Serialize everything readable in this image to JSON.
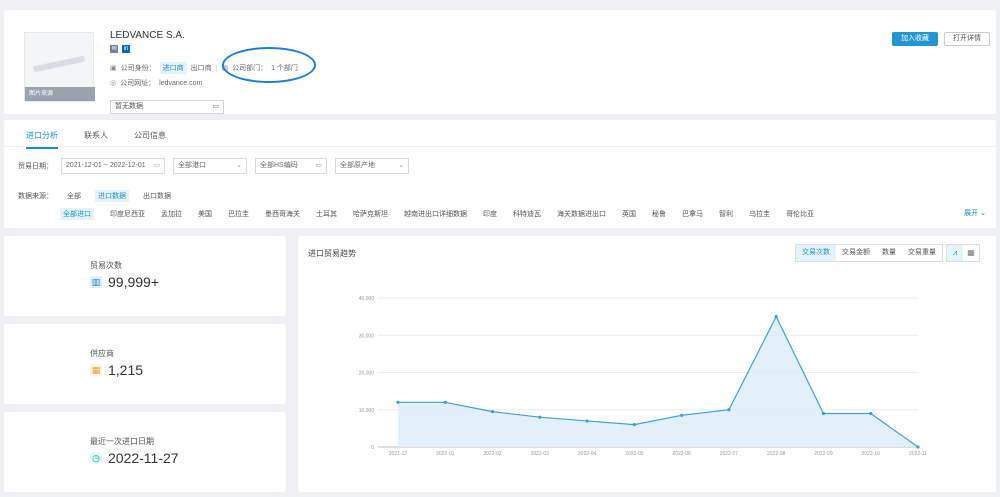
{
  "header": {
    "company_name": "LEDVANCE S.A.",
    "logo_badge": "图片来源",
    "role_label": "公司身份：",
    "role_tag_1": "进口商",
    "role_tag_2": "出口商",
    "dept_label": "公司部门：",
    "dept_value": "1 个部门",
    "website_label": "公司网址：",
    "website_value": "ledvance.com",
    "date_value": "暂无数据",
    "add_button": "加入收藏",
    "open_button": "打开详情"
  },
  "tabs": [
    {
      "label": "进口分析",
      "active": true
    },
    {
      "label": "联系人",
      "active": false
    },
    {
      "label": "公司信息",
      "active": false
    }
  ],
  "filters": {
    "date_label": "贸易日期：",
    "date_start": "2021-12-01",
    "date_sep": "~",
    "date_end": "2022-12-01",
    "region": "全部港口",
    "category": "全部HS编码",
    "country": "全部原产地"
  },
  "source": {
    "label": "数据来源：",
    "items": [
      {
        "label": "全部",
        "selected": false
      },
      {
        "label": "进口数据",
        "selected": true
      },
      {
        "label": "出口数据",
        "selected": false
      }
    ]
  },
  "categories": {
    "items": [
      "全部进口",
      "印度尼西亚",
      "孟加拉",
      "美国",
      "巴拉圭",
      "墨西哥海关",
      "土耳其",
      "哈萨克斯坦",
      "越南进出口详细数据",
      "印度",
      "科特迪瓦",
      "海关数据进出口",
      "英国",
      "秘鲁",
      "巴拿马",
      "智利",
      "乌拉圭",
      "哥伦比亚"
    ],
    "expand_label": "展开"
  },
  "stats": [
    {
      "label": "贸易次数",
      "value": "99,999+",
      "icon": "bar-chart-icon",
      "color": "#2a7fd4",
      "bg": "#e1eefb"
    },
    {
      "label": "供应商",
      "value": "1,215",
      "icon": "store-icon",
      "color": "#e6a23c",
      "bg": "#fdf3e2"
    },
    {
      "label": "最近一次进口日期",
      "value": "2022-11-27",
      "icon": "clock-icon",
      "color": "#23b2a7",
      "bg": "#e0f5f3"
    }
  ],
  "chart_header": {
    "title": "进口贸易趋势",
    "metrics": [
      {
        "label": "交易次数",
        "active": true
      },
      {
        "label": "交易金额",
        "active": false
      },
      {
        "label": "数量",
        "active": false
      },
      {
        "label": "交易重量",
        "active": false
      }
    ],
    "views": [
      {
        "icon": "line-chart-icon",
        "glyph": "⩘",
        "active": true
      },
      {
        "icon": "table-icon",
        "glyph": "▦",
        "active": false
      }
    ]
  },
  "chart_data": {
    "type": "area",
    "title": "进口贸易趋势",
    "x": [
      "2021-12",
      "2022-01",
      "2022-02",
      "2022-03",
      "2022-04",
      "2022-05",
      "2022-06",
      "2022-07",
      "2022-08",
      "2022-09",
      "2022-10",
      "2022-11"
    ],
    "values": [
      12000,
      12000,
      9500,
      8000,
      7000,
      6000,
      8500,
      10000,
      35000,
      9000,
      9000,
      0
    ],
    "ylim": [
      0,
      40000
    ],
    "yticks": [
      0,
      10000,
      20000,
      30000,
      40000
    ],
    "ytick_labels": [
      "0",
      "10,000",
      "20,000",
      "30,000",
      "40,000"
    ],
    "grid": true,
    "line_color": "#3ca0d8",
    "fill_color": "#d9ecfa"
  }
}
